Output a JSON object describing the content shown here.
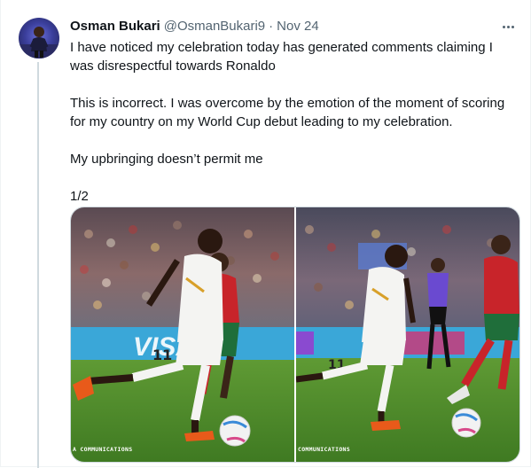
{
  "tweet": {
    "author_name": "Osman Bukari",
    "handle": "@OsmanBukari9",
    "separator": "·",
    "date": "Nov 24",
    "paragraphs": [
      "I have noticed my celebration today has generated comments claiming I was disrespectful towards Ronaldo",
      "This is incorrect. I was overcome by the emotion of the moment of scoring for my country on my World Cup debut leading to my celebration.",
      "My upbringing doesn’t permit me",
      "1/2"
    ],
    "more_icon": "ellipsis-icon",
    "media": [
      {
        "watermark": "A COMMUNICATIONS",
        "ad_board_text": "VISA"
      },
      {
        "watermark": "COMMUNICATIONS",
        "shirt_numbers": "11"
      }
    ]
  },
  "colors": {
    "text_primary": "#0f1419",
    "text_secondary": "#536471",
    "thread_line": "#cfd9de",
    "pitch_green": "#4f8a2b"
  }
}
